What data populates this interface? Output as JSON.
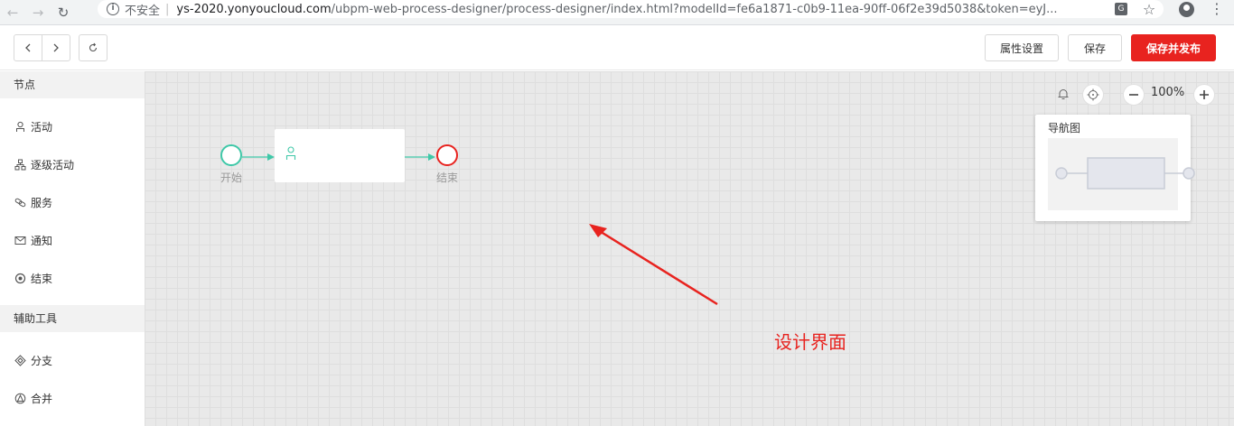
{
  "browser": {
    "insecure_label": "不安全",
    "url_host": "ys-2020.yonyoucloud.com",
    "url_path": "/ubpm-web-process-designer/process-designer/index.html?modelId=fe6a1871-c0b9-11ea-90ff-06f2e39d5038&token=eyJ..."
  },
  "header": {
    "properties_label": "属性设置",
    "save_label": "保存",
    "publish_label": "保存并发布"
  },
  "sidebar": {
    "nodes_title": "节点",
    "nodes": [
      {
        "label": "活动",
        "icon": "person-icon"
      },
      {
        "label": "逐级活动",
        "icon": "org-tree-icon"
      },
      {
        "label": "服务",
        "icon": "link-icon"
      },
      {
        "label": "通知",
        "icon": "mail-icon"
      },
      {
        "label": "结束",
        "icon": "end-circle-icon"
      }
    ],
    "tools_title": "辅助工具",
    "tools": [
      {
        "label": "分支",
        "icon": "diamond-icon"
      },
      {
        "label": "合并",
        "icon": "merge-icon"
      }
    ]
  },
  "canvas": {
    "zoom": "100%",
    "navigator_title": "导航图",
    "start_label": "开始",
    "end_label": "结束",
    "annotation": "设计界面",
    "colors": {
      "start": "#3fc8a8",
      "end": "#e8231f",
      "accent": "#e8231f"
    }
  }
}
